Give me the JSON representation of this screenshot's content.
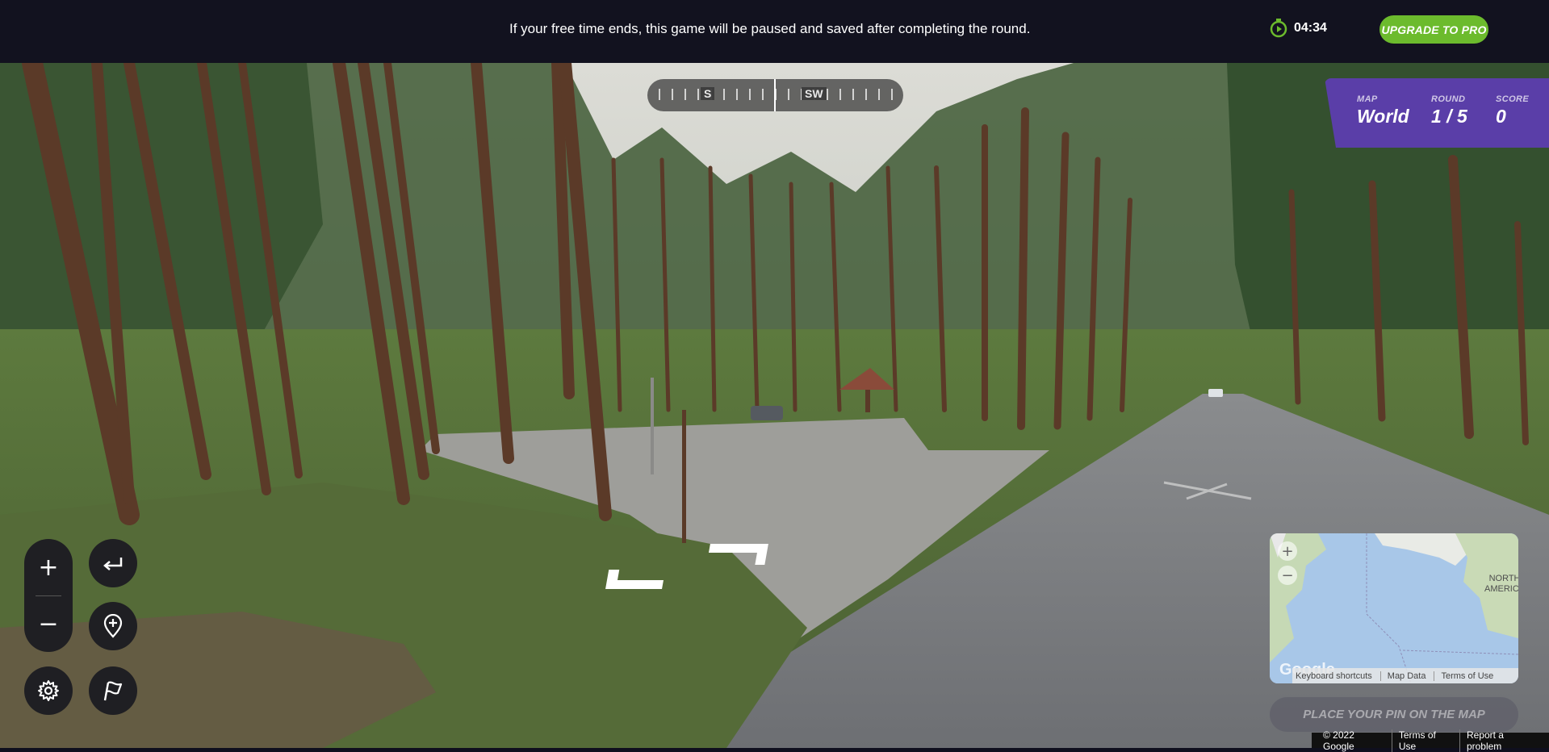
{
  "banner": {
    "message": "If your free time ends, this game will be paused and saved after completing the round.",
    "timer": "04:34",
    "upgrade_label": "UPGRADE TO PRO"
  },
  "compass": {
    "directions": [
      {
        "label": "S"
      },
      {
        "label": "SW"
      }
    ]
  },
  "status": {
    "map_label": "MAP",
    "map_value": "World",
    "round_label": "ROUND",
    "round_value": "1 / 5",
    "score_label": "SCORE",
    "score_value": "0"
  },
  "controls": {
    "zoom_in": "+",
    "zoom_out": "−"
  },
  "minimap": {
    "zoom_in": "+",
    "zoom_out": "−",
    "region_label_line1": "NORTH",
    "region_label_line2": "AMERICA",
    "logo": "Google",
    "attribution": [
      "Keyboard shortcuts",
      "Map Data",
      "Terms of Use"
    ]
  },
  "guess_button": "PLACE YOUR PIN ON THE MAP",
  "google_footer": [
    "© 2022 Google",
    "Terms of Use",
    "Report a problem"
  ],
  "colors": {
    "banner_bg": "#12121f",
    "upgrade_green": "#6cbb2d",
    "status_purple": "#5a3ea8",
    "timer_green": "#6cbb2d"
  },
  "icons": [
    "timer-icon",
    "undo-arrow-icon",
    "return-to-start-pin-icon",
    "settings-gear-icon",
    "flag-icon"
  ]
}
